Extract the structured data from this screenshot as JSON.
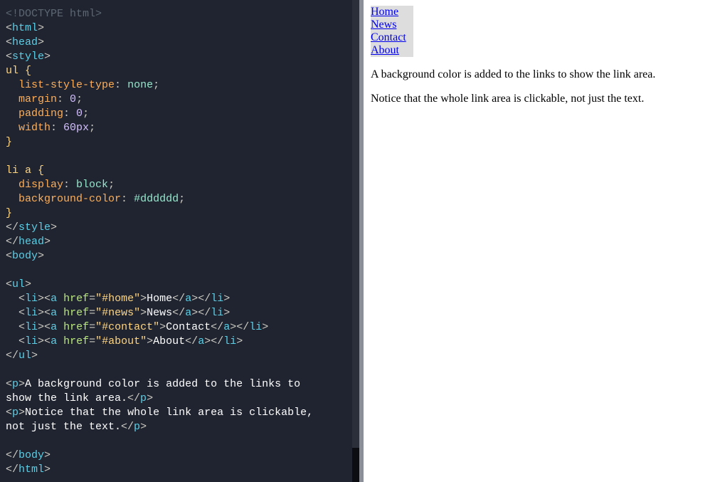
{
  "code": {
    "doctype": "<!DOCTYPE html>",
    "tag_html_open": "html",
    "tag_head_open": "head",
    "tag_style_open": "style",
    "sel_ul": "ul {",
    "prop_list_style": "list-style-type",
    "val_none": "none",
    "prop_margin": "margin",
    "val_0a": "0",
    "prop_padding": "padding",
    "val_0b": "0",
    "prop_width": "width",
    "val_60px": "60px",
    "close_brace1": "}",
    "sel_li_a": "li a {",
    "prop_display": "display",
    "val_block": "block",
    "prop_bg": "background-color",
    "val_ddd": "#dddddd",
    "close_brace2": "}",
    "tag_style_close": "style",
    "tag_head_close": "head",
    "tag_body_open": "body",
    "tag_ul_open": "ul",
    "li1_href": "\"#home\"",
    "li1_text": "Home",
    "li2_href": "\"#news\"",
    "li2_text": "News",
    "li3_href": "\"#contact\"",
    "li3_text": "Contact",
    "li4_href": "\"#about\"",
    "li4_text": "About",
    "tag_ul_close": "ul",
    "p1_text": "A background color is added to the links to show the link area.",
    "p2_text": "Notice that the whole link area is clickable, not just the text.",
    "tag_body_close": "body",
    "tag_html_close": "html",
    "attr_href": "href",
    "tag_li": "li",
    "tag_a": "a",
    "tag_p": "p"
  },
  "preview": {
    "nav": {
      "items": [
        {
          "label": "Home"
        },
        {
          "label": "News"
        },
        {
          "label": "Contact"
        },
        {
          "label": "About"
        }
      ]
    },
    "para1": "A background color is added to the links to show the link area.",
    "para2": "Notice that the whole link area is clickable, not just the text."
  }
}
